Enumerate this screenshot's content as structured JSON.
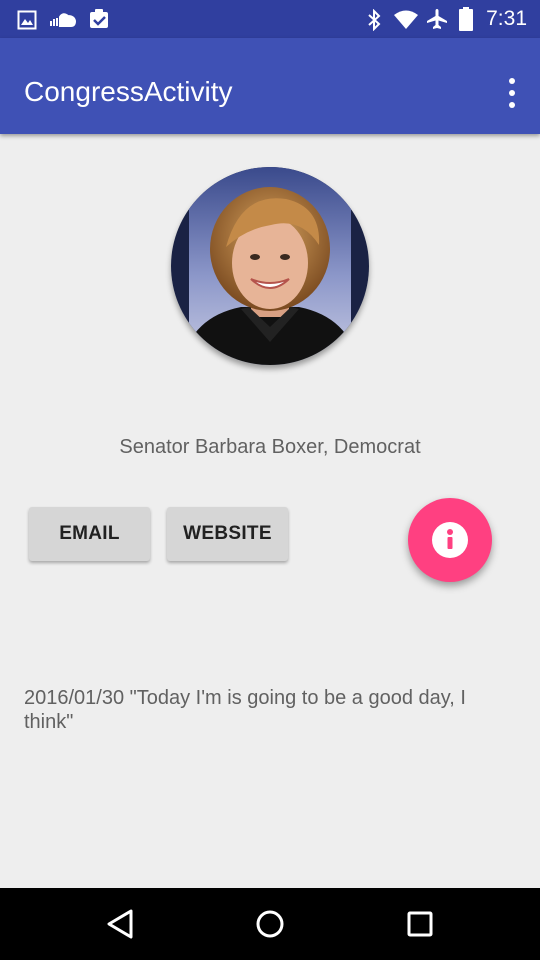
{
  "status_bar": {
    "time": "7:31",
    "left_icons": [
      "image-icon",
      "cloud-icon",
      "clipboard-check-icon"
    ],
    "right_icons": [
      "bluetooth-icon",
      "wifi-icon",
      "airplane-icon",
      "battery-icon"
    ]
  },
  "app_bar": {
    "title": "CongressActivity",
    "menu_icon": "more-vert-icon",
    "color": "#3f51b5"
  },
  "profile": {
    "name_line": "Senator Barbara Boxer, Democrat"
  },
  "actions": {
    "email_label": "EMAIL",
    "website_label": "WEBSITE",
    "fab_icon": "info-icon",
    "fab_color": "#ff4081"
  },
  "tweet": {
    "text": "2016/01/30 \"Today I'm is going to be a good day, I think\""
  },
  "nav_bar": {
    "icons": [
      "back-icon",
      "home-icon",
      "recents-icon"
    ]
  }
}
